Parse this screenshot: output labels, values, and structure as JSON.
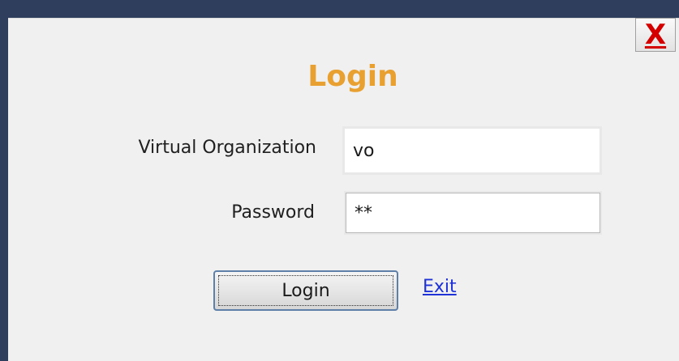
{
  "dialog": {
    "title": "Login",
    "close_icon": "close-icon",
    "close_glyph": "X",
    "close_color": "#d40000",
    "title_color": "#e8a030"
  },
  "form": {
    "vo_label": "Virtual Organization",
    "vo_value": "vo",
    "password_label": "Password",
    "password_value": "**"
  },
  "actions": {
    "login_label": "Login",
    "exit_label": "Exit",
    "link_color": "#1e32d8"
  }
}
